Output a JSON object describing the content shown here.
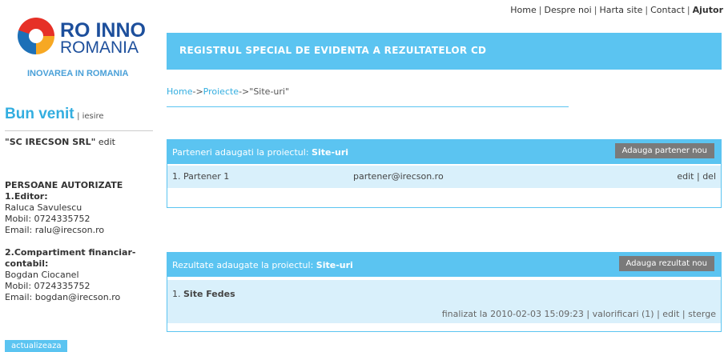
{
  "topnav": {
    "home": "Home",
    "about": "Despre noi",
    "sitemap": "Harta site",
    "contact": "Contact",
    "help": "Ajutor"
  },
  "logo": {
    "line1": "RO INNO",
    "line2": "ROMANIA",
    "tagline": "INOVAREA IN ROMANIA"
  },
  "sidebar": {
    "welcome": "Bun venit",
    "logout": "| iesire",
    "company_name": "\"SC IRECSON SRL\"",
    "company_edit": "edit",
    "auth_heading": "PERSOANE AUTORIZATE",
    "editor_heading": "1.Editor:",
    "editor_name": "Raluca Savulescu",
    "editor_phone": "Mobil: 0724335752",
    "editor_email": "Email: ralu@irecson.ro",
    "finance_heading": "2.Compartiment financiar-contabil:",
    "finance_name": "Bogdan Ciocanel",
    "finance_phone": "Mobil: 0724335752",
    "finance_email": "Email: bogdan@irecson.ro",
    "update_button": "actualizeaza"
  },
  "banner": {
    "title": "REGISTRUL SPECIAL DE EVIDENTA A REZULTATELOR CD"
  },
  "breadcrumb": {
    "home": "Home",
    "arrow1": "->",
    "projects": "Proiecte",
    "arrow2": "->",
    "current": "\"Site-uri\""
  },
  "partners_panel": {
    "title_prefix": "Parteneri adaugati la proiectul: ",
    "project": "Site-uri",
    "add_button": "Adauga partener nou",
    "rows": [
      {
        "name": "1. Partener 1",
        "email": "partener@irecson.ro",
        "actions": "edit | del"
      }
    ]
  },
  "results_panel": {
    "title_prefix": "Rezultate adaugate la proiectul: ",
    "project": "Site-uri",
    "add_button": "Adauga rezultat nou",
    "rows": [
      {
        "index": "1.",
        "name": "Site Fedes",
        "status": "finalizat la 2010-02-03 15:09:23 | valorificari (1) | edit | sterge"
      }
    ]
  }
}
